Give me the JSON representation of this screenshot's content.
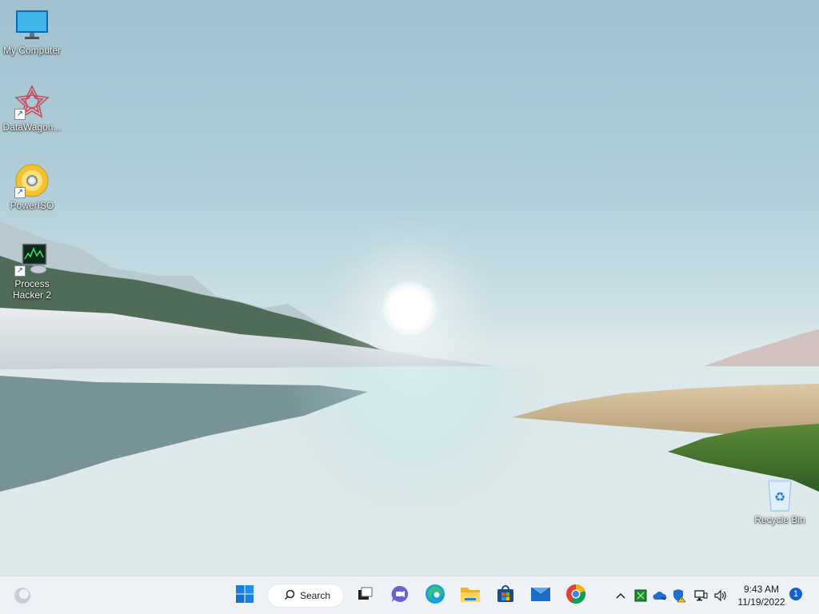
{
  "desktop": {
    "icons": [
      {
        "label": "My Computer",
        "icon": "monitor-icon"
      },
      {
        "label": "DataWagon...",
        "icon": "datawagon-icon"
      },
      {
        "label": "PowerISO",
        "icon": "poweriso-disc-icon"
      },
      {
        "label": "Process Hacker 2",
        "icon": "process-hacker-icon"
      },
      {
        "label": "Recycle Bin",
        "icon": "recycle-bin-icon"
      }
    ]
  },
  "taskbar": {
    "search_label": "Search",
    "apps": [
      "start-icon",
      "search-icon",
      "task-view-icon",
      "chat-icon",
      "edge-icon",
      "file-explorer-icon",
      "store-icon",
      "mail-icon",
      "chrome-icon"
    ],
    "tray": [
      "chevron-up-icon",
      "green-app-icon",
      "onedrive-icon",
      "security-warning-icon",
      "network-icon",
      "volume-icon"
    ],
    "clock": {
      "time": "9:43 AM",
      "date": "11/19/2022"
    },
    "notification_count": "1"
  },
  "colors": {
    "accent": "#1560c8",
    "taskbar_bg": "#eef1f6"
  }
}
